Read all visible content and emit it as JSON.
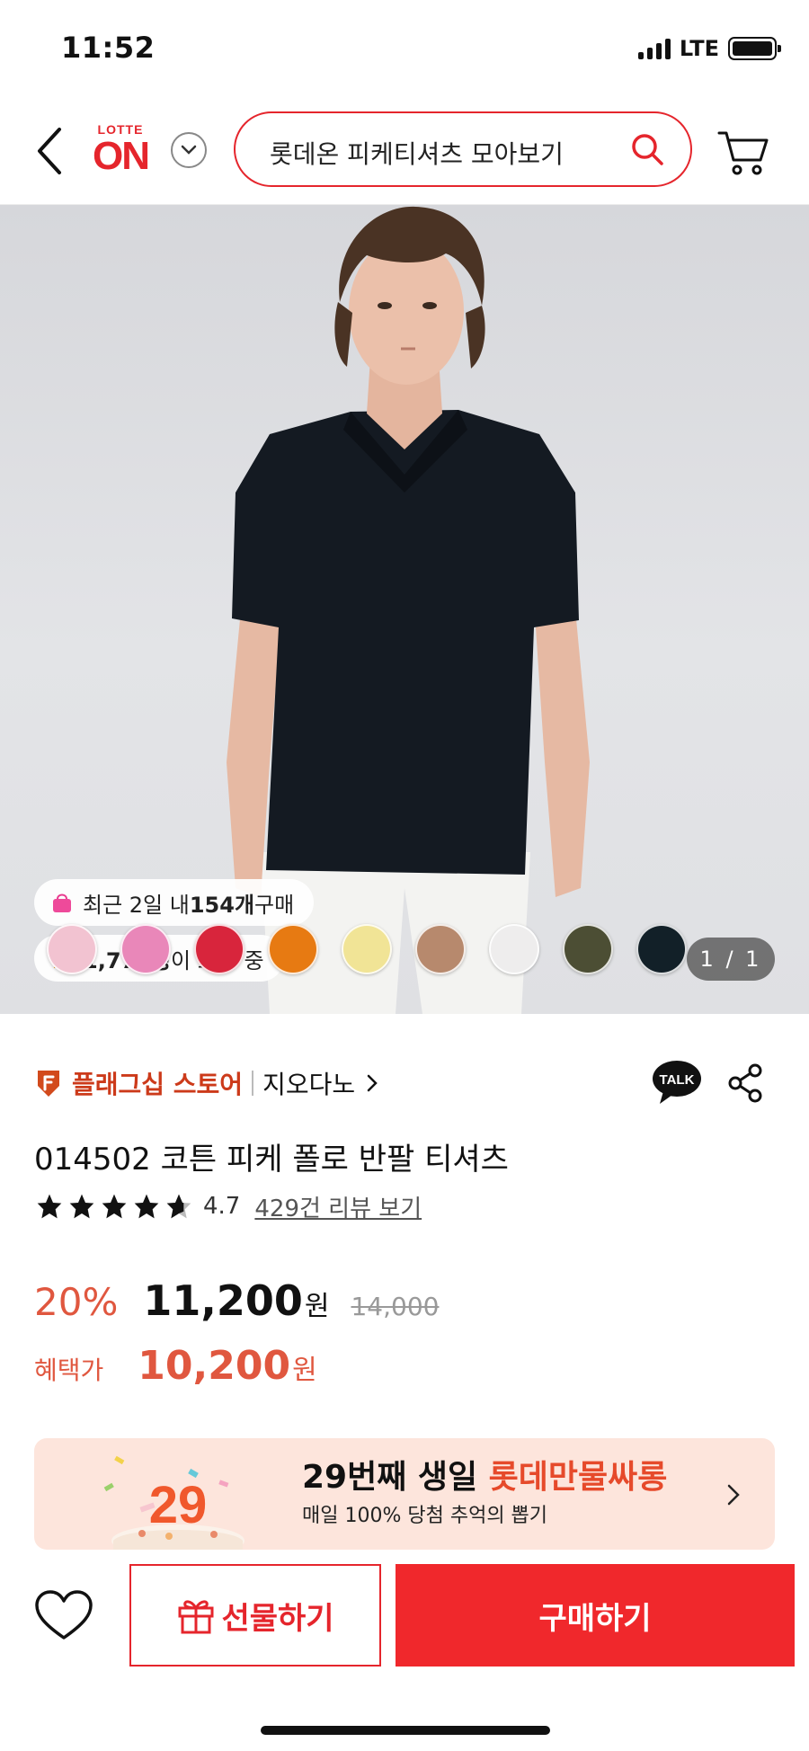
{
  "status_bar": {
    "time": "11:52",
    "network": "LTE"
  },
  "header": {
    "logo_top": "LOTTE",
    "logo_main": "ON",
    "search_placeholder": "롯데온 피케티셔츠 모아보기"
  },
  "hero": {
    "recent_buy_prefix": "최근 2일 내 ",
    "recent_buy_count": "154개",
    "recent_buy_suffix": " 구매",
    "viewers_count": "1,773명",
    "viewers_suffix": "이 보는 중",
    "image_counter": "1 / 1",
    "swatch_colors": [
      "#f2c3d1",
      "#e987b9",
      "#d8253c",
      "#e77a12",
      "#f1e496",
      "#b7896d",
      "#eeeded",
      "#4c4e34",
      "#122028"
    ]
  },
  "store": {
    "flag_label": "플래그십 스토어",
    "brand_name": "지오다노",
    "talk_label": "TALK"
  },
  "product": {
    "title": "014502 코튼 피케 폴로 반팔 티셔츠",
    "rating": "4.7",
    "review_link": "429건 리뷰 보기"
  },
  "price": {
    "discount": "20%",
    "sale_price": "11,200",
    "currency": "원",
    "original_price": "14,000",
    "benefit_label": "혜택가",
    "benefit_price": "10,200",
    "benefit_currency": "원"
  },
  "banner": {
    "cake_number": "29",
    "title_black": "29번째 생일 ",
    "title_red": "롯데만물싸롱",
    "subtitle": "매일 100% 당첨 추억의 뽑기"
  },
  "bottom": {
    "gift_label": "선물하기",
    "buy_label": "구매하기"
  },
  "colors": {
    "brand_red": "#e5252c",
    "price_red": "#e0573f",
    "banner_bg": "#fde5dc"
  }
}
